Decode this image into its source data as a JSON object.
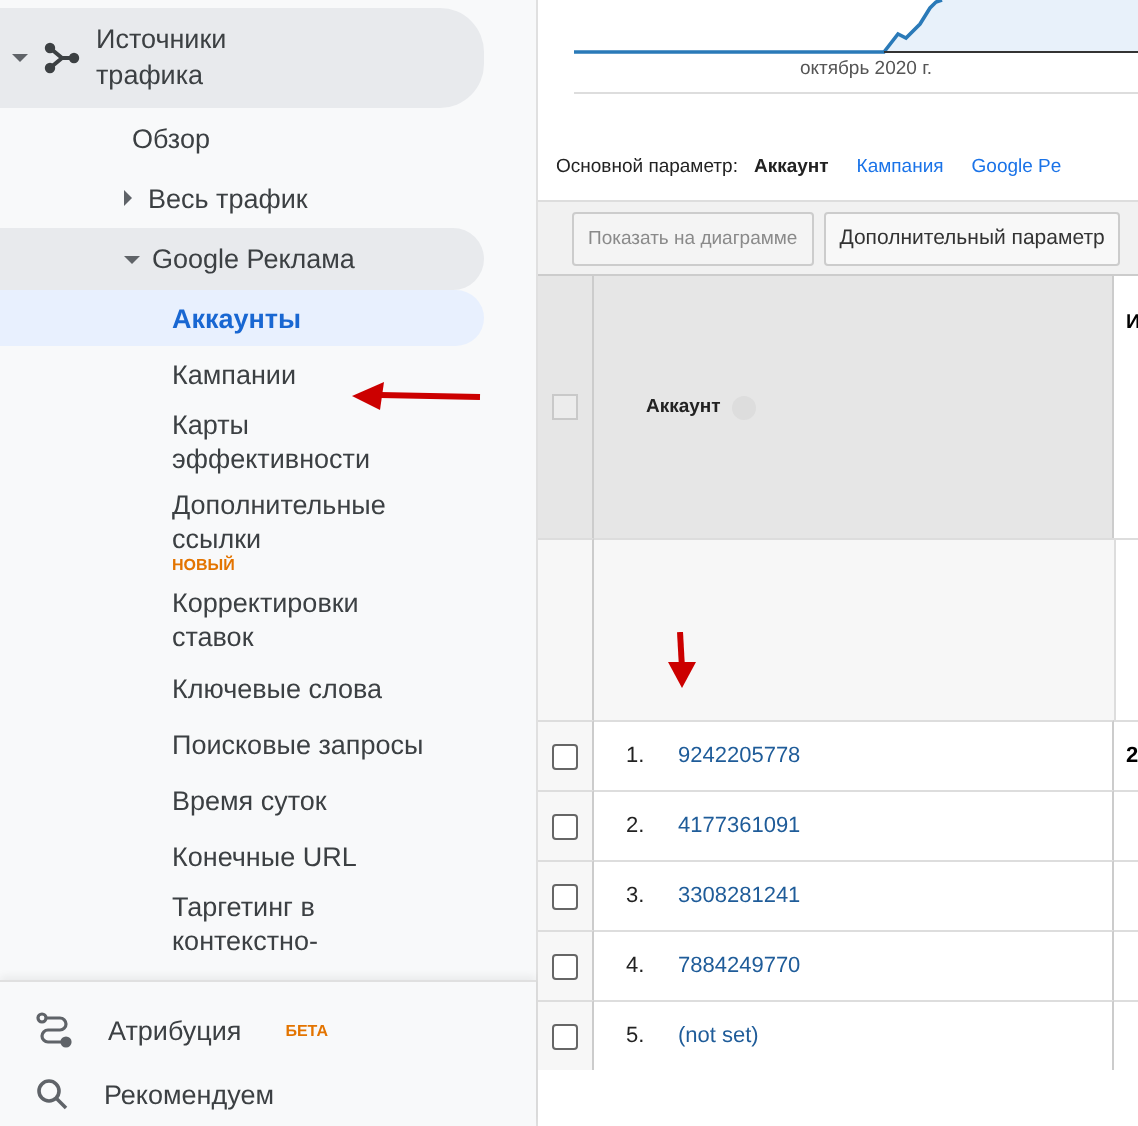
{
  "sidebar": {
    "section": {
      "title": "Источники трафика",
      "expanded": true
    },
    "items": [
      {
        "label": "Обзор",
        "kind": "link"
      },
      {
        "label": "Весь трафик",
        "kind": "group",
        "expanded": false
      },
      {
        "label": "Google Реклама",
        "kind": "group",
        "expanded": true,
        "children": [
          {
            "label": "Аккаунты",
            "selected": true
          },
          {
            "label": "Кампании",
            "selected": false
          },
          {
            "label": "Карты эффективности",
            "selected": false
          },
          {
            "label": "Дополнительные ссылки",
            "selected": false,
            "badge": "НОВЫЙ"
          },
          {
            "label": "Корректировки ставок",
            "selected": false
          },
          {
            "label": "Ключевые слова",
            "selected": false
          },
          {
            "label": "Поисковые запросы",
            "selected": false
          },
          {
            "label": "Время суток",
            "selected": false
          },
          {
            "label": "Конечные URL",
            "selected": false
          },
          {
            "label": "Таргетинг в контекстно-",
            "selected": false
          }
        ]
      }
    ],
    "bottom": [
      {
        "label": "Атрибуция",
        "badge": "БЕТА"
      },
      {
        "label": "Рекомендуем"
      }
    ]
  },
  "chart": {
    "xlabel": "октябрь 2020 г."
  },
  "dimension": {
    "label": "Основной параметр:",
    "options": [
      {
        "label": "Аккаунт",
        "selected": true
      },
      {
        "label": "Кампания",
        "selected": false
      },
      {
        "label": "Google Pe",
        "selected": false
      }
    ]
  },
  "toolbar": {
    "buttons": [
      {
        "label": "Показать на диаграмме",
        "disabled": true
      },
      {
        "label": "Дополнительный параметр",
        "disabled": false
      }
    ]
  },
  "table": {
    "columns": [
      "Аккаунт",
      "И"
    ],
    "all_checked": false,
    "rows": [
      {
        "index": "1.",
        "account": "9242205778",
        "column_2": "2",
        "checked": false
      },
      {
        "index": "2.",
        "account": "4177361091",
        "checked": false
      },
      {
        "index": "3.",
        "account": "3308281241",
        "checked": false
      },
      {
        "index": "4.",
        "account": "7884249770",
        "checked": false
      },
      {
        "index": "5.",
        "account": "(not set)",
        "checked": false
      }
    ]
  }
}
